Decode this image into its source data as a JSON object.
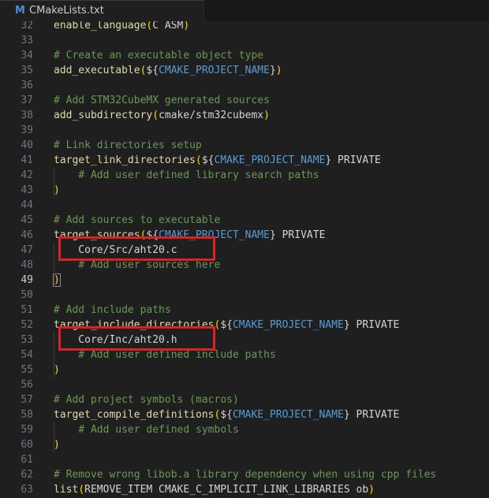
{
  "tab": {
    "icon": "M",
    "filename": "CMakeLists.txt"
  },
  "lines": [
    {
      "n": "32",
      "text": "enable_language(C ASM)"
    },
    {
      "n": "33",
      "text": ""
    },
    {
      "n": "34",
      "text": "# Create an executable object type"
    },
    {
      "n": "35",
      "text": "add_executable(${CMAKE_PROJECT_NAME})"
    },
    {
      "n": "36",
      "text": ""
    },
    {
      "n": "37",
      "text": "# Add STM32CubeMX generated sources"
    },
    {
      "n": "38",
      "text": "add_subdirectory(cmake/stm32cubemx)"
    },
    {
      "n": "39",
      "text": ""
    },
    {
      "n": "40",
      "text": "# Link directories setup"
    },
    {
      "n": "41",
      "text": "target_link_directories(${CMAKE_PROJECT_NAME} PRIVATE"
    },
    {
      "n": "42",
      "text": "    # Add user defined library search paths"
    },
    {
      "n": "43",
      "text": ")"
    },
    {
      "n": "44",
      "text": ""
    },
    {
      "n": "45",
      "text": "# Add sources to executable"
    },
    {
      "n": "46",
      "text": "target_sources(${CMAKE_PROJECT_NAME} PRIVATE"
    },
    {
      "n": "47",
      "text": "    Core/Src/aht20.c"
    },
    {
      "n": "48",
      "text": "    # Add user sources here"
    },
    {
      "n": "49",
      "text": ")"
    },
    {
      "n": "50",
      "text": ""
    },
    {
      "n": "51",
      "text": "# Add include paths"
    },
    {
      "n": "52",
      "text": "target_include_directories(${CMAKE_PROJECT_NAME} PRIVATE"
    },
    {
      "n": "53",
      "text": "    Core/Inc/aht20.h"
    },
    {
      "n": "54",
      "text": "    # Add user defined include paths"
    },
    {
      "n": "55",
      "text": ")"
    },
    {
      "n": "56",
      "text": ""
    },
    {
      "n": "57",
      "text": "# Add project symbols (macros)"
    },
    {
      "n": "58",
      "text": "target_compile_definitions(${CMAKE_PROJECT_NAME} PRIVATE"
    },
    {
      "n": "59",
      "text": "    # Add user defined symbols"
    },
    {
      "n": "60",
      "text": ")"
    },
    {
      "n": "61",
      "text": ""
    },
    {
      "n": "62",
      "text": "# Remove wrong libob.a library dependency when using cpp files"
    },
    {
      "n": "63",
      "text": "list(REMOVE_ITEM CMAKE_C_IMPLICIT_LINK_LIBRARIES ob)"
    }
  ],
  "current_line": "49",
  "highlighted_lines": [
    "47",
    "53"
  ],
  "colors": {
    "comment": "#6a9955",
    "function": "#dcdcaa",
    "paren": "#ffd700",
    "variable": "#569cd6",
    "highlight_box": "#e02020"
  }
}
